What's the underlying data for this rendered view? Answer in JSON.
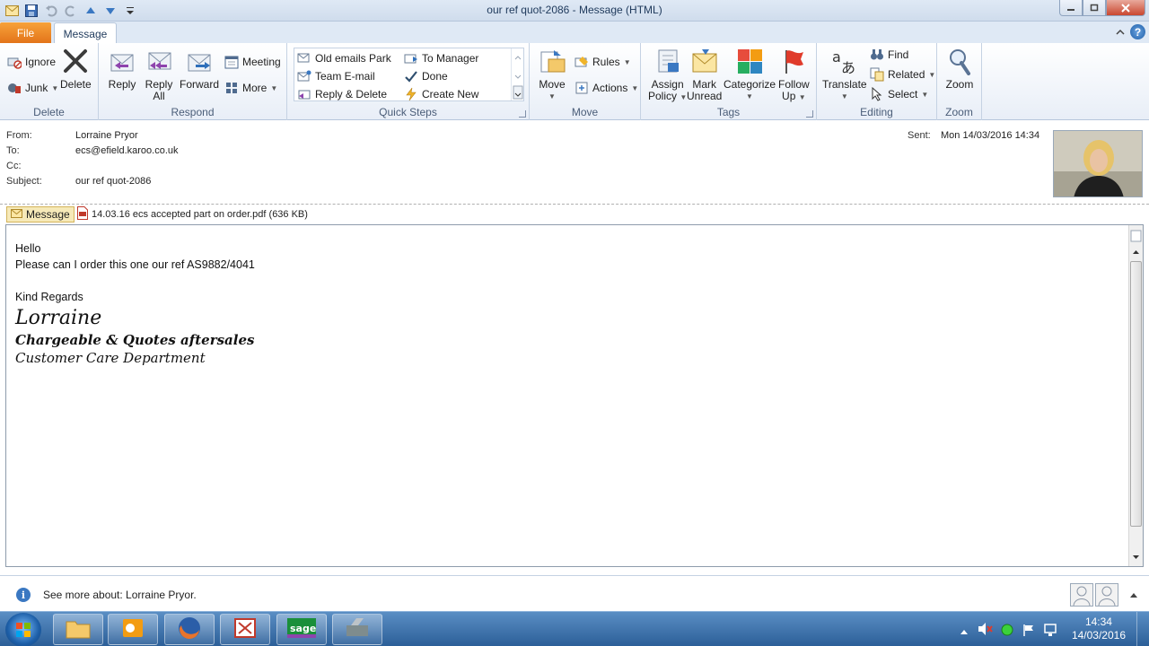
{
  "window": {
    "title": "our ref quot-2086  -  Message (HTML)"
  },
  "tabs": {
    "file": "File",
    "message": "Message"
  },
  "ribbon": {
    "delete_group": {
      "label": "Delete",
      "ignore": "Ignore",
      "junk": "Junk",
      "delete": "Delete"
    },
    "respond_group": {
      "label": "Respond",
      "reply": "Reply",
      "reply_all_1": "Reply",
      "reply_all_2": "All",
      "forward": "Forward",
      "meeting": "Meeting",
      "more": "More"
    },
    "quick_steps": {
      "label": "Quick Steps",
      "items": [
        "Old emails Park",
        "Team E-mail",
        "Reply & Delete",
        "To Manager",
        "Done",
        "Create New"
      ]
    },
    "move_group": {
      "label": "Move",
      "move": "Move",
      "rules": "Rules",
      "actions": "Actions"
    },
    "tags_group": {
      "label": "Tags",
      "assign_1": "Assign",
      "assign_2": "Policy",
      "mark_1": "Mark",
      "mark_2": "Unread",
      "categorize": "Categorize",
      "follow_1": "Follow",
      "follow_2": "Up"
    },
    "editing_group": {
      "label": "Editing",
      "translate": "Translate",
      "find": "Find",
      "related": "Related",
      "select": "Select"
    },
    "zoom_group": {
      "label": "Zoom",
      "zoom": "Zoom"
    }
  },
  "header": {
    "from_label": "From:",
    "from": "Lorraine Pryor",
    "to_label": "To:",
    "to": "ecs@efield.karoo.co.uk",
    "cc_label": "Cc:",
    "cc": "",
    "subject_label": "Subject:",
    "subject": "our ref quot-2086",
    "sent_label": "Sent:",
    "sent": "Mon 14/03/2016 14:34"
  },
  "attachments": {
    "message_tab": "Message",
    "file": "14.03.16 ecs accepted part on order.pdf (636 KB)"
  },
  "body": {
    "greeting": "Hello",
    "line1": "Please can I order this one  our ref AS9882/4041",
    "regards": "Kind Regards",
    "sig_name": "Lorraine",
    "sig_role": "Chargeable & Quotes aftersales",
    "sig_dept": "Customer Care Department"
  },
  "people_pane": {
    "text": "See more about: Lorraine Pryor."
  },
  "taskbar": {
    "time": "14:34",
    "date": "14/03/2016"
  },
  "colors": {
    "file_tab": "#e3741a",
    "ribbon_label": "#4a5d78",
    "taskbar": "#2c5f98"
  }
}
